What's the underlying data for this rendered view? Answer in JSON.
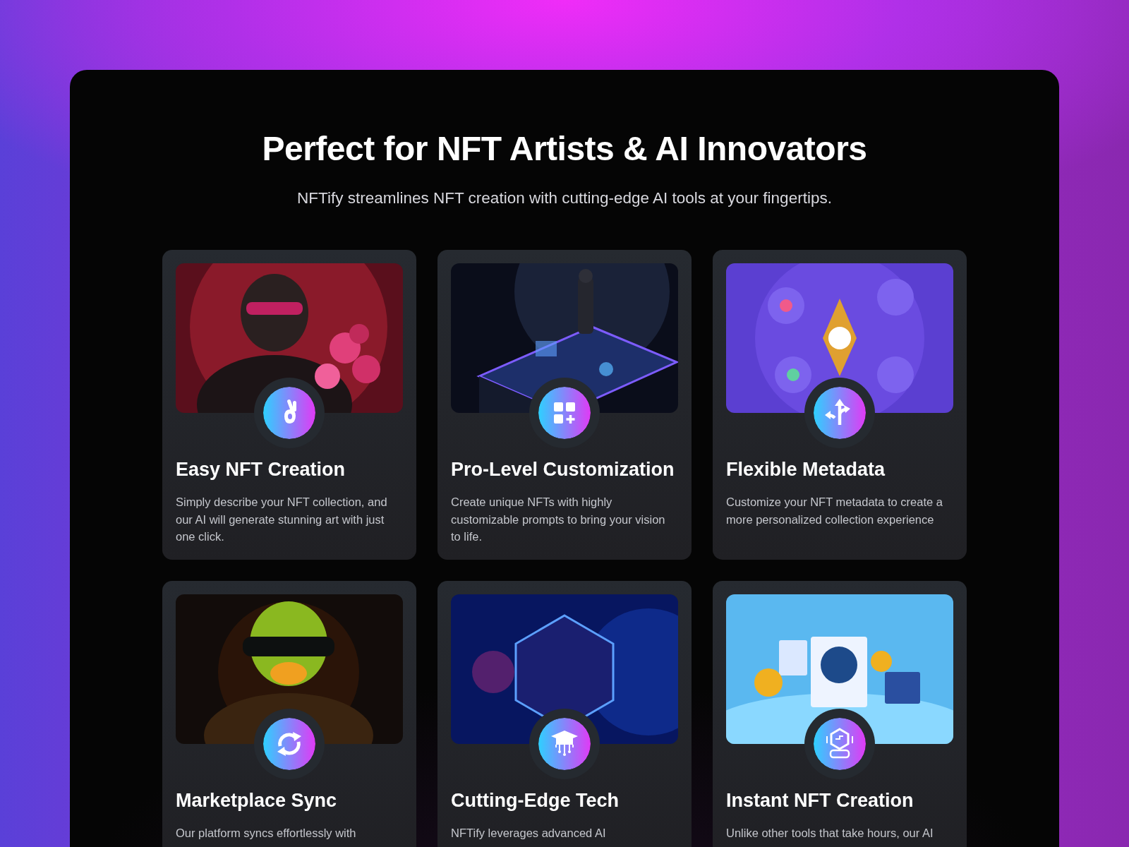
{
  "heading": "Perfect for NFT Artists & AI Innovators",
  "subheading": "NFTify streamlines NFT creation with cutting-edge AI tools at your fingertips.",
  "cards": [
    {
      "title": "Easy NFT Creation",
      "description": "Simply describe your NFT collection, and our AI will generate stunning art with just one click."
    },
    {
      "title": "Pro-Level Customization",
      "description": "Create unique NFTs with highly customizable prompts to bring your vision to life."
    },
    {
      "title": "Flexible Metadata",
      "description": "Customize your NFT metadata to create a more personalized collection experience"
    },
    {
      "title": "Marketplace Sync",
      "description": "Our platform syncs effortlessly with"
    },
    {
      "title": "Cutting-Edge Tech",
      "description": "NFTify leverages advanced AI"
    },
    {
      "title": "Instant NFT Creation",
      "description": "Unlike other tools that take hours, our AI"
    }
  ]
}
